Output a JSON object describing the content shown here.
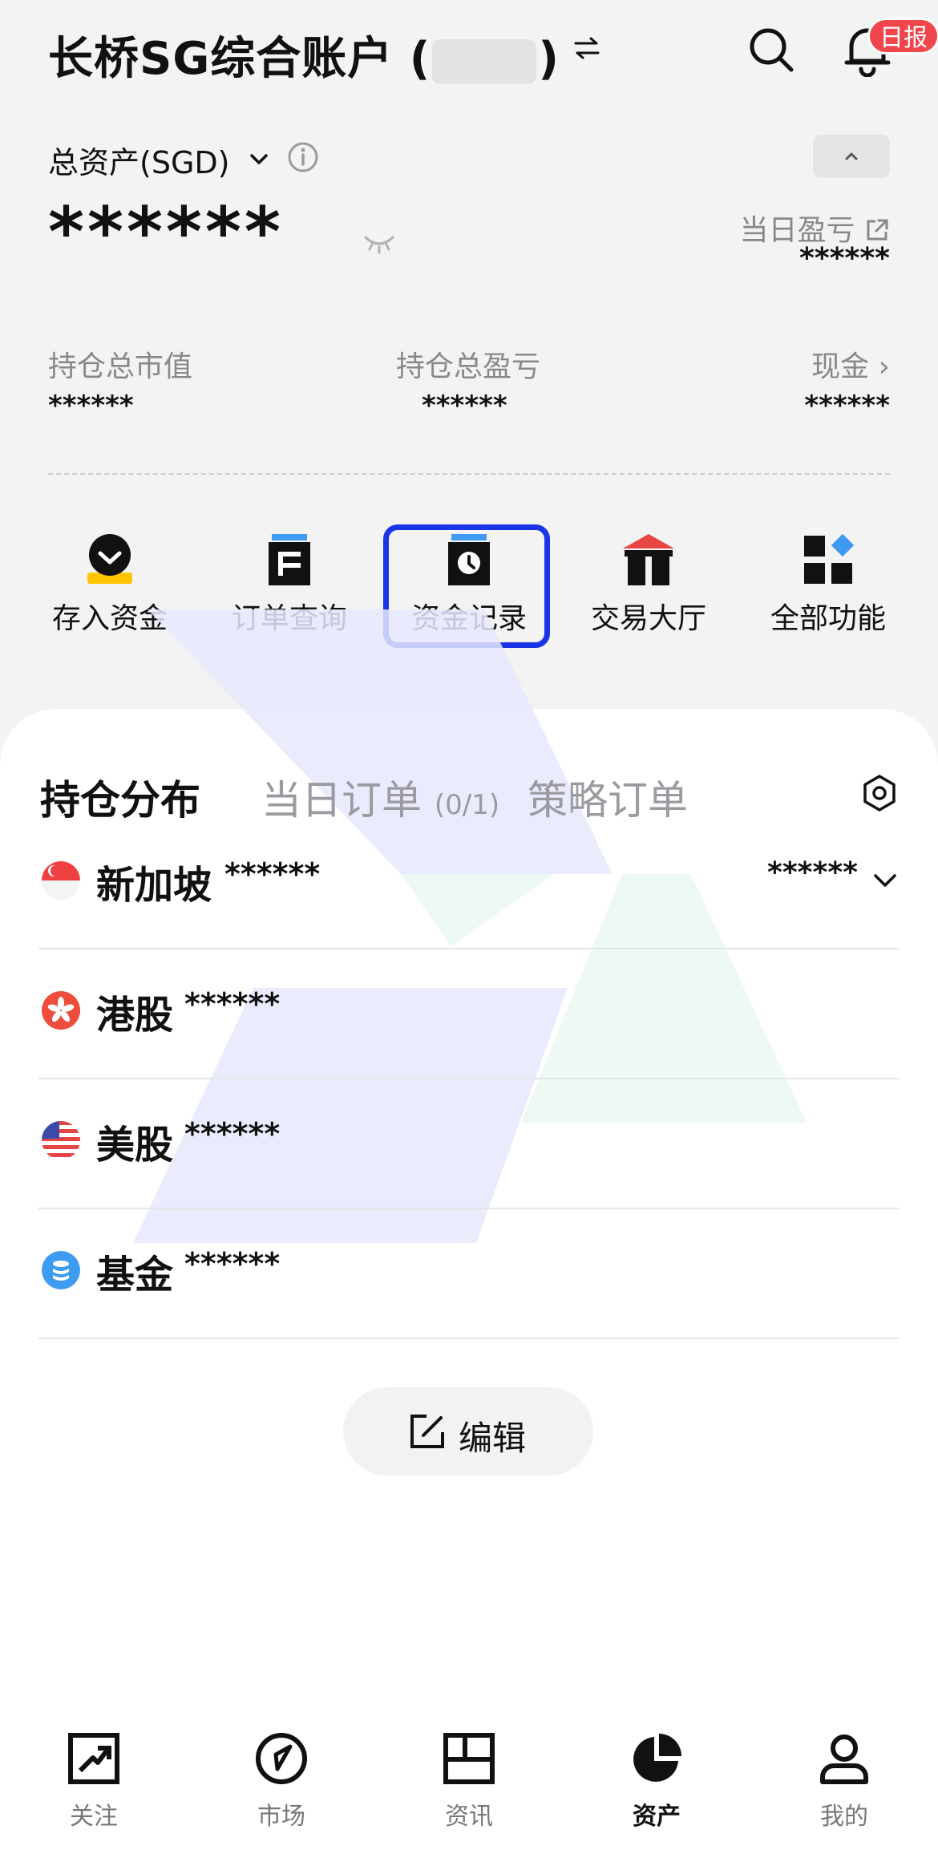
{
  "header": {
    "account_prefix": "长桥SG综合账户 (",
    "account_suffix": ")",
    "badge": "日报"
  },
  "summary": {
    "total_label": "总资产(SGD)",
    "total_value": "******",
    "day_pl_label": "当日盈亏",
    "day_pl_value": "******",
    "stats": [
      {
        "label": "持仓总市值",
        "value": "******"
      },
      {
        "label": "持仓总盈亏",
        "value": "******"
      },
      {
        "label": "现金 ›",
        "value": "******"
      }
    ]
  },
  "quick_actions": [
    {
      "label": "存入资金",
      "icon": "deposit-icon"
    },
    {
      "label": "订单查询",
      "icon": "order-query-icon"
    },
    {
      "label": "资金记录",
      "icon": "fund-record-icon"
    },
    {
      "label": "交易大厅",
      "icon": "trading-hall-icon"
    },
    {
      "label": "全部功能",
      "icon": "all-functions-icon"
    }
  ],
  "tabs": {
    "holdings": "持仓分布",
    "today_orders": "当日订单",
    "today_orders_count": "(0/1)",
    "strategy_orders": "策略订单"
  },
  "markets": [
    {
      "name": "新加坡",
      "amount": "******",
      "right_amount": "******",
      "flag": "singapore-flag-icon"
    },
    {
      "name": "港股",
      "amount": "******",
      "flag": "hongkong-flag-icon"
    },
    {
      "name": "美股",
      "amount": "******",
      "flag": "us-flag-icon"
    },
    {
      "name": "基金",
      "amount": "******",
      "flag": "fund-icon"
    }
  ],
  "edit_label": "编辑",
  "nav": [
    {
      "label": "关注",
      "icon": "watchlist-icon"
    },
    {
      "label": "市场",
      "icon": "market-icon"
    },
    {
      "label": "资讯",
      "icon": "news-icon"
    },
    {
      "label": "资产",
      "icon": "assets-icon",
      "active": true
    },
    {
      "label": "我的",
      "icon": "profile-icon"
    }
  ],
  "colors": {
    "accent_highlight": "#1a35e6",
    "badge_red": "#f0454b",
    "deposit_yellow": "#ffc400",
    "icon_blue": "#3d9bf2",
    "hall_red": "#e94545"
  }
}
